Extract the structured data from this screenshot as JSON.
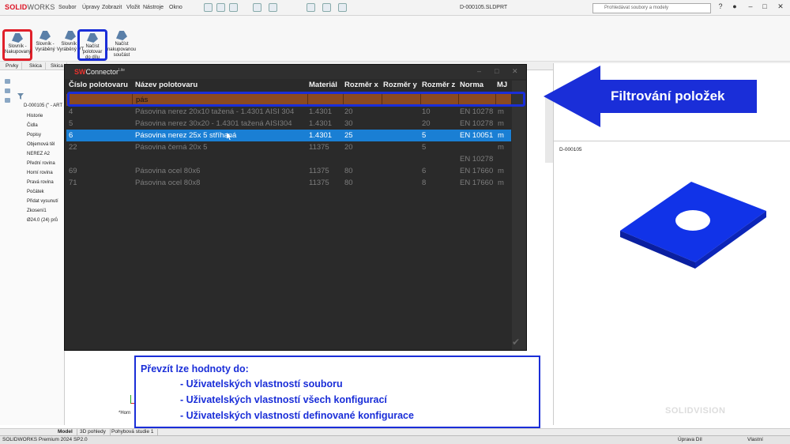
{
  "app": {
    "brand_bold": "SOLID",
    "brand_rest": "WORKS",
    "document_title": "D-000105.SLDPRT",
    "menu": [
      "Soubor",
      "Úpravy",
      "Zobrazit",
      "Vložit",
      "Nástroje",
      "Okno"
    ],
    "search_placeholder": "Prohledávat soubory a modely"
  },
  "ribbon": {
    "buttons": [
      {
        "label": "Slovník - Nakupovaný"
      },
      {
        "label": "Slovník - Vyráběný"
      },
      {
        "label": "Slovník - Vyráběný VT"
      },
      {
        "label": "Načíst polotovar do dílu"
      },
      {
        "label": "Načíst nakupovanou součást"
      }
    ]
  },
  "tabs": [
    "Prvky",
    "Skica",
    "Skica"
  ],
  "tree": {
    "root": "D-000105 (\" - ART 2",
    "items": [
      "Historie",
      "Čidla",
      "Popisy",
      "Objemová těl",
      "NEREZ A2",
      "Přední rovina",
      "Horní rovina",
      "Pravá rovina",
      "Počátek",
      "Přidat vysunutí",
      "Zkosení1",
      "Ø24.0 (24) prů"
    ]
  },
  "dialog": {
    "title_sv": "SW",
    "title_rest": "Connector",
    "title_suffix": "Lite",
    "columns": [
      "Číslo polotovaru",
      "Název polotovaru",
      "Materiál",
      "Rozměr x",
      "Rozměr y",
      "Rozměr z",
      "Norma",
      "MJ"
    ],
    "filter_value": "pás",
    "rows": [
      {
        "cislo": "4",
        "nazev": "Pásovina nerez  20x10 tažená - 1.4301 AISI 304",
        "material": "1.4301",
        "x": "20",
        "y": "",
        "z": "10",
        "norma": "EN 10278",
        "mj": "m"
      },
      {
        "cislo": "5",
        "nazev": "Pásovina nerez  30x20 - 1.4301 tažená AISI304",
        "material": "1.4301",
        "x": "30",
        "y": "",
        "z": "20",
        "norma": "EN 10278",
        "mj": "m"
      },
      {
        "cislo": "6",
        "nazev": "Pásovina nerez  25x 5 stříhaná",
        "material": "1.4301",
        "x": "25",
        "y": "",
        "z": "5",
        "norma": "EN 10051",
        "mj": "m"
      },
      {
        "cislo": "22",
        "nazev": "Pásovina černá  20x 5",
        "material": "11375",
        "x": "20",
        "y": "",
        "z": "5",
        "norma": "",
        "mj": "m"
      },
      {
        "cislo": "",
        "nazev": "",
        "material": "",
        "x": "",
        "y": "",
        "z": "",
        "norma": "EN 10278",
        "mj": ""
      },
      {
        "cislo": "69",
        "nazev": "Pásovina ocel 80x6",
        "material": "11375",
        "x": "80",
        "y": "",
        "z": "6",
        "norma": "EN 17660",
        "mj": "m"
      },
      {
        "cislo": "71",
        "nazev": "Pásovina ocel 80x8",
        "material": "11375",
        "x": "80",
        "y": "",
        "z": "8",
        "norma": "EN 17660",
        "mj": "m"
      }
    ],
    "selected_row": 2
  },
  "annotation": {
    "arrow_label": "Filtrování položek",
    "info_heading": "Převzít lze hodnoty do:",
    "info_items": [
      "-  Uživatelských vlastností souboru",
      "-  Uživatelských vlastností všech konfigurací",
      "-  Uživatelských vlastností definované konfigurace"
    ],
    "arrow_color": "#1a2ed8",
    "highlight_red": "#e0202a"
  },
  "part": {
    "name": "D-000105",
    "color": "#1030e0"
  },
  "bottom": {
    "tabs": [
      "Model",
      "3D pohledy",
      "Pohybová studie 1"
    ],
    "status_left": "SOLIDWORKS Premium 2024 SP2.0",
    "status_mid": "Úprava Díl",
    "status_right": "Vlastní",
    "watermark": "SOLIDVISION",
    "view_label": "*Horn"
  }
}
